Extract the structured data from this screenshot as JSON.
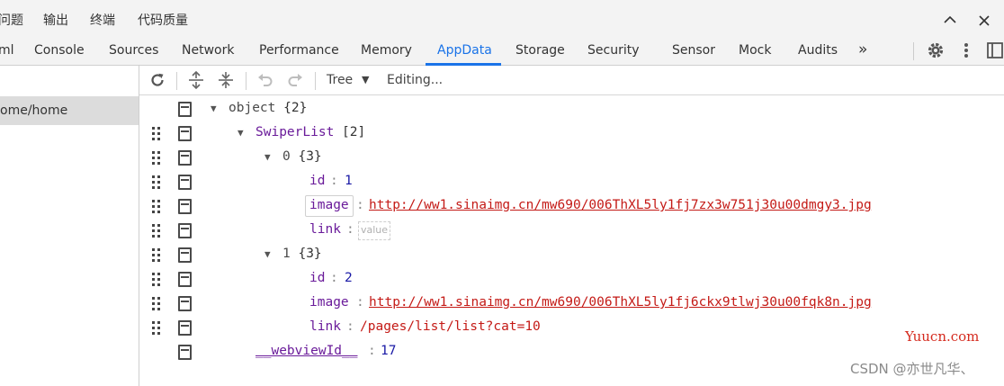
{
  "menubar": {
    "items": [
      "问题",
      "输出",
      "终端",
      "代码质量"
    ],
    "controls": {
      "collapse": "^",
      "close": "✕"
    }
  },
  "tabs": {
    "items": [
      "ml",
      "Console",
      "Sources",
      "Network",
      "Performance",
      "Memory",
      "AppData",
      "Storage",
      "Security",
      "Sensor",
      "Mock",
      "Audits"
    ],
    "active": "AppData",
    "more": "»",
    "accent_color": "#1a73e8"
  },
  "sidebar": {
    "selected_label": "ome/home"
  },
  "toolbar": {
    "mode_label": "Tree",
    "dropdown_arrow": "▼",
    "status_label": "Editing..."
  },
  "tree": {
    "root": {
      "key": "object",
      "count": "{2}"
    },
    "swiper": {
      "key": "SwiperList",
      "count": "[2]"
    },
    "item0": {
      "index": "0",
      "count": "{3}",
      "id_key": "id",
      "id_value": "1",
      "image_key": "image",
      "image_value": "http://ww1.sinaimg.cn/mw690/006ThXL5ly1fj7zx3w751j30u00dmgy3.jpg",
      "link_key": "link",
      "link_placeholder": "value"
    },
    "item1": {
      "index": "1",
      "count": "{3}",
      "id_key": "id",
      "id_value": "2",
      "image_key": "image",
      "image_value": "http://ww1.sinaimg.cn/mw690/006ThXL5ly1fj6ckx9tlwj30u00fqk8n.jpg",
      "link_key": "link",
      "link_value": "/pages/list/list?cat=10"
    },
    "webview": {
      "key": "__webviewId__",
      "value": "17"
    },
    "colon": ":"
  },
  "watermarks": {
    "site": "Yuucn.com",
    "author": "CSDN @亦世凡华、"
  }
}
